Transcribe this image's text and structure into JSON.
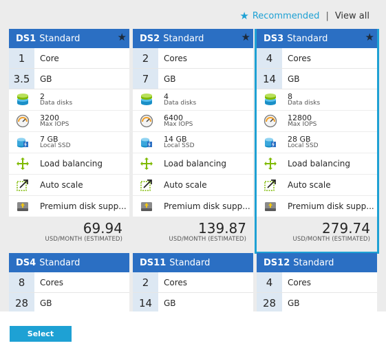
{
  "header": {
    "recommended_label": "Recommended",
    "separator": "|",
    "view_all_label": "View all",
    "accent_color": "#1ea1d4"
  },
  "cards": [
    {
      "name": "DS1",
      "tier": "Standard",
      "specs": [
        {
          "value": "1",
          "unit": "Core"
        },
        {
          "value": "3.5",
          "unit": "GB"
        }
      ],
      "disks": {
        "value": "2",
        "label": "Data disks"
      },
      "iops": {
        "value": "3200",
        "label": "Max IOPS"
      },
      "ssd": {
        "value": "7 GB",
        "label": "Local SSD"
      },
      "load_balancing": "Load balancing",
      "auto_scale": "Auto scale",
      "premium": "Premium disk supp...",
      "price": "69.94",
      "price_unit": "USD/MONTH (ESTIMATED)"
    },
    {
      "name": "DS2",
      "tier": "Standard",
      "specs": [
        {
          "value": "2",
          "unit": "Cores"
        },
        {
          "value": "7",
          "unit": "GB"
        }
      ],
      "disks": {
        "value": "4",
        "label": "Data disks"
      },
      "iops": {
        "value": "6400",
        "label": "Max IOPS"
      },
      "ssd": {
        "value": "14 GB",
        "label": "Local SSD"
      },
      "load_balancing": "Load balancing",
      "auto_scale": "Auto scale",
      "premium": "Premium disk supp...",
      "price": "139.87",
      "price_unit": "USD/MONTH (ESTIMATED)"
    },
    {
      "name": "DS3",
      "tier": "Standard",
      "specs": [
        {
          "value": "4",
          "unit": "Cores"
        },
        {
          "value": "14",
          "unit": "GB"
        }
      ],
      "disks": {
        "value": "8",
        "label": "Data disks"
      },
      "iops": {
        "value": "12800",
        "label": "Max IOPS"
      },
      "ssd": {
        "value": "28 GB",
        "label": "Local SSD"
      },
      "load_balancing": "Load balancing",
      "auto_scale": "Auto scale",
      "premium": "Premium disk supp...",
      "price": "279.74",
      "price_unit": "USD/MONTH (ESTIMATED)"
    },
    {
      "name": "DS4",
      "tier": "Standard",
      "specs": [
        {
          "value": "8",
          "unit": "Cores"
        },
        {
          "value": "28",
          "unit": "GB"
        }
      ]
    },
    {
      "name": "DS11",
      "tier": "Standard",
      "specs": [
        {
          "value": "2",
          "unit": "Cores"
        },
        {
          "value": "14",
          "unit": "GB"
        }
      ]
    },
    {
      "name": "DS12",
      "tier": "Standard",
      "specs": [
        {
          "value": "4",
          "unit": "Cores"
        },
        {
          "value": "28",
          "unit": "GB"
        }
      ]
    }
  ],
  "footer": {
    "select_label": "Select"
  }
}
